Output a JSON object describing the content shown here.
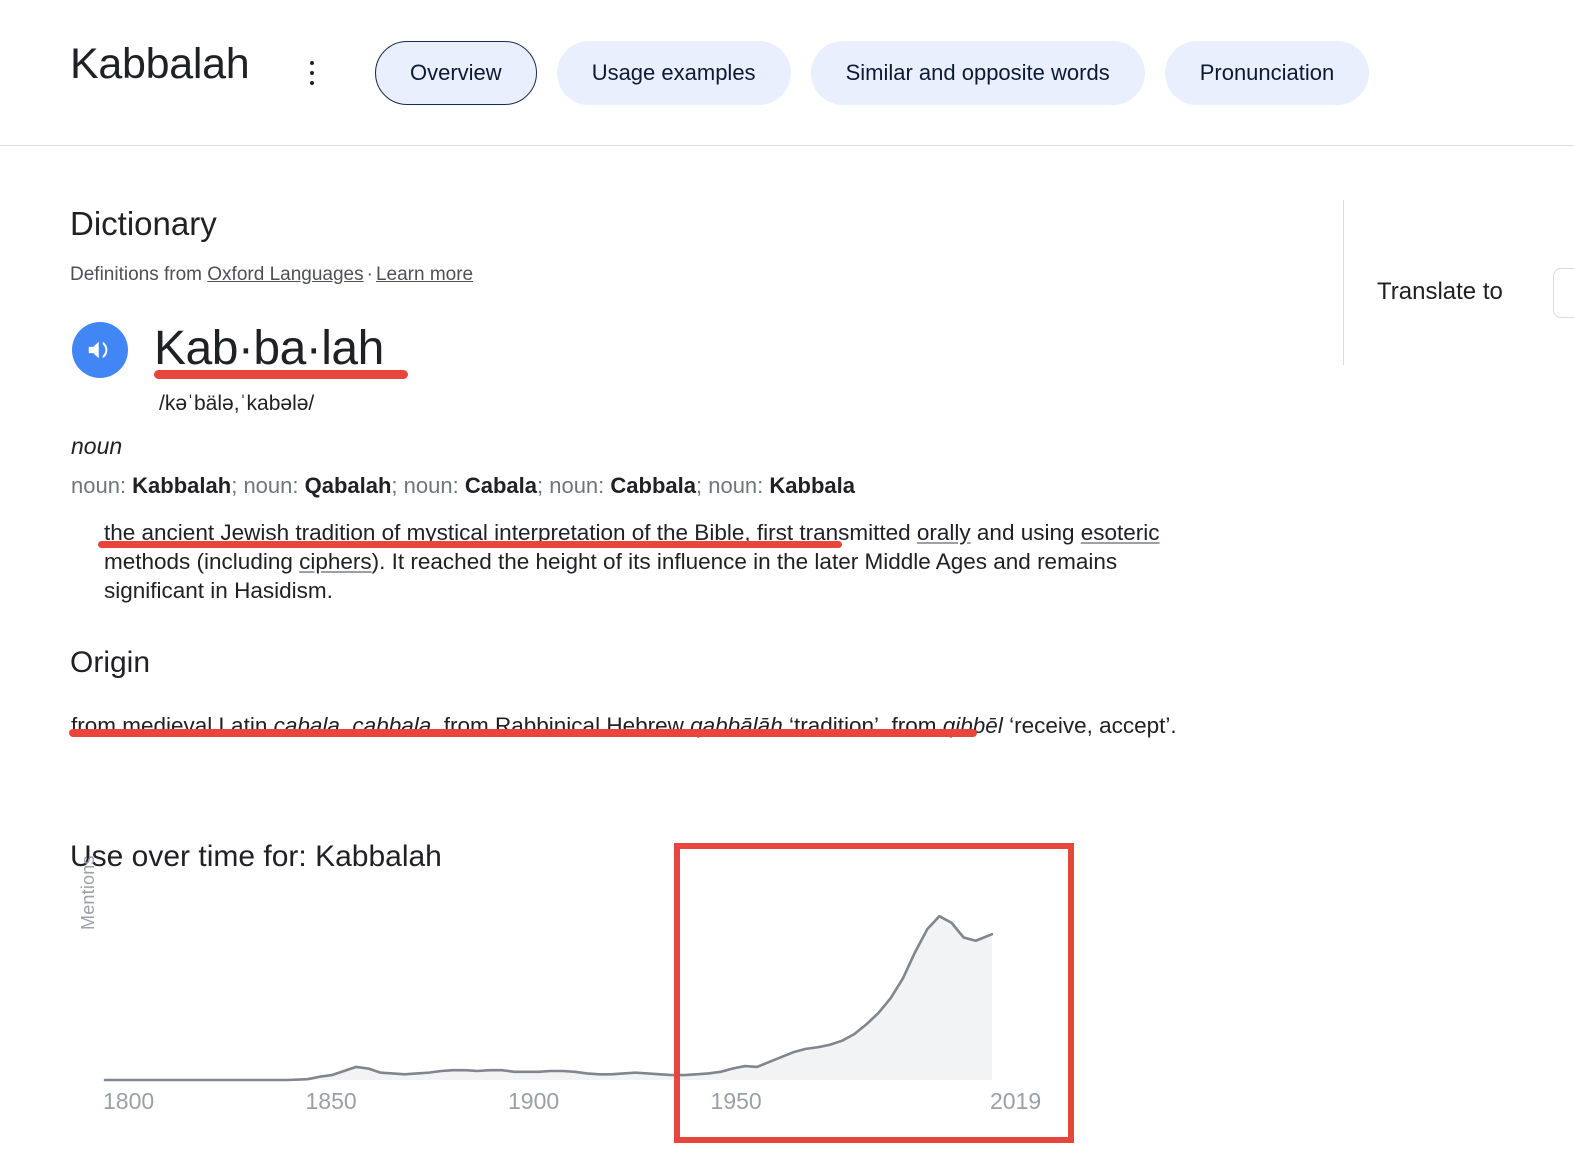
{
  "header": {
    "word": "Kabbalah",
    "menu_icon": "more-vert-icon",
    "tabs": [
      {
        "label": "Overview",
        "selected": true
      },
      {
        "label": "Usage examples",
        "selected": false
      },
      {
        "label": "Similar and opposite words",
        "selected": false
      },
      {
        "label": "Pronunciation",
        "selected": false
      }
    ]
  },
  "dictionary": {
    "heading": "Dictionary",
    "source_prefix": "Definitions from ",
    "source_link": "Oxford Languages",
    "separator": "·",
    "learn_more": "Learn more",
    "speaker_icon": "volume-up-icon",
    "headword": "Kab·ba·lah",
    "phonetic": "/kəˈbälə,ˈkabələ/",
    "part_of_speech": "noun",
    "variants_plain": "noun: Kabbalah; noun: Qabalah; noun: Cabala; noun: Cabbala; noun: Kabbala",
    "variants": [
      {
        "label": "noun: ",
        "term": "Kabbalah"
      },
      {
        "label": "noun: ",
        "term": "Qabalah"
      },
      {
        "label": "noun: ",
        "term": "Cabala"
      },
      {
        "label": "noun: ",
        "term": "Cabbala"
      },
      {
        "label": "noun: ",
        "term": "Kabbala"
      }
    ],
    "definition_plain": "the ancient Jewish tradition of mystical interpretation of the Bible, first transmitted orally and using esoteric methods (including ciphers). It reached the height of its influence in the later Middle Ages and remains significant in Hasidism.",
    "definition_parts": {
      "p1": "the ancient Jewish tradition of mystical interpretation of the Bible, first transmitted ",
      "link1": "orally",
      "p2": " and using ",
      "link2": "esoteric",
      "p3": " methods (including ",
      "link3": "ciphers",
      "p4": "). It reached the height of its influence in the later Middle Ages and remains significant in Hasidism."
    }
  },
  "origin": {
    "heading": "Origin",
    "text_plain": "from medieval Latin cabala, cabbala, from Rabbinical Hebrew qabbālāh ‘tradition’, from qibbēl ‘receive, accept’.",
    "parts": {
      "p1": "from medieval Latin ",
      "i1": "cabala",
      "p2": ", ",
      "i2": "cabbala",
      "p3": ", from Rabbinical Hebrew ",
      "i3": "qabbālāh",
      "p4": " ‘tradition’, from ",
      "i4": "qibbēl",
      "p5": " ‘receive, accept’."
    }
  },
  "annotations": {
    "highlight_color": "#e8453c",
    "underlines": [
      {
        "name": "headword-underline",
        "target": "Kab·ba·lah"
      },
      {
        "name": "definition-underline",
        "target": "the ancient Jewish tradition of mystical interpretation of the Bible,"
      },
      {
        "name": "origin-underline",
        "target": "from medieval Latin cabala, cabbala, from Rabbinical Hebrew qabbālāh ‘tradition’,"
      }
    ],
    "box": {
      "name": "chart-highlight-box",
      "target": "use-over-time chart right portion, 1950-2019"
    }
  },
  "right_panel": {
    "translate_label": "Translate to",
    "language_select_value": ""
  },
  "chart_data": {
    "type": "area",
    "title": "Use over time for: Kabbalah",
    "xlabel": "",
    "ylabel": "Mentions",
    "xlim": [
      1800,
      2019
    ],
    "tick_labels": [
      "1800",
      "1850",
      "1900",
      "1950",
      "2019"
    ],
    "ticks": [
      1800,
      1850,
      1900,
      1950,
      2019
    ],
    "grid": false,
    "legend": false,
    "line_color": "#80868b",
    "fill_color": "#f1f3f4",
    "x": [
      1800,
      1810,
      1820,
      1830,
      1840,
      1845,
      1850,
      1853,
      1856,
      1859,
      1862,
      1865,
      1868,
      1871,
      1874,
      1877,
      1880,
      1883,
      1886,
      1889,
      1892,
      1895,
      1898,
      1901,
      1904,
      1907,
      1910,
      1913,
      1916,
      1919,
      1922,
      1925,
      1928,
      1931,
      1934,
      1937,
      1940,
      1943,
      1946,
      1949,
      1952,
      1955,
      1958,
      1961,
      1964,
      1967,
      1970,
      1973,
      1976,
      1979,
      1982,
      1985,
      1988,
      1991,
      1994,
      1997,
      2000,
      2003,
      2006,
      2009,
      2012,
      2015,
      2019
    ],
    "values": [
      0,
      0,
      0,
      0,
      0,
      0,
      0.5,
      2.0,
      3.0,
      5.5,
      8.0,
      7.0,
      4.5,
      4.0,
      3.5,
      4.0,
      4.5,
      5.5,
      6.0,
      6.0,
      5.5,
      6.0,
      6.0,
      5.0,
      5.0,
      5.0,
      5.5,
      5.5,
      5.0,
      4.0,
      3.5,
      3.5,
      4.0,
      4.5,
      4.0,
      3.5,
      3.0,
      3.0,
      3.5,
      4.0,
      5.0,
      7.0,
      8.5,
      8.0,
      11.0,
      14.0,
      17.0,
      19.0,
      20.0,
      21.5,
      24.0,
      28.0,
      34.0,
      41.0,
      50.0,
      62.0,
      78.0,
      92.0,
      100.0,
      96.0,
      87.0,
      85.0,
      89.0
    ],
    "ymax": 105
  }
}
